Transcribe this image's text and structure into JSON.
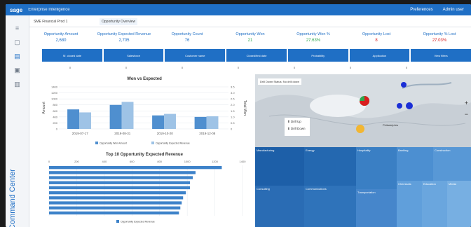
{
  "topbar": {
    "logo": "sage",
    "title": "Enterprise Intelligence",
    "right": [
      "Preferences",
      "Admin user"
    ]
  },
  "sidebar": {
    "command_center": "Command Center",
    "icons": [
      "list-icon",
      "panel-icon",
      "chart-icon",
      "folder-icon",
      "files-icon"
    ]
  },
  "tabs": [
    {
      "label": "SME Financial Prod 1"
    },
    {
      "label": "Opportunity Overview"
    }
  ],
  "kpis": [
    {
      "label": "Opportunity Amount",
      "value": "2,680"
    },
    {
      "label": "Opportunity Expected Revenue",
      "value": "2,705"
    },
    {
      "label": "Opportunity Count",
      "value": "76"
    },
    {
      "label": "Opportunity Won",
      "value": "21"
    },
    {
      "label": "Opportunity Won %",
      "value": "27.63%"
    },
    {
      "label": "Opportunity Lost",
      "value": "8"
    },
    {
      "label": "Opportunity % Lost",
      "value": "27.03%"
    }
  ],
  "filters": [
    "Sf. closed date",
    "Salesforce",
    "Customer name",
    "Closed/first date",
    "Probability",
    "Application",
    "View filters"
  ],
  "filter_values": [
    "0",
    "0",
    "0",
    "0",
    "0",
    "0",
    "0"
  ],
  "win_chart": {
    "title": "Won vs Expected",
    "ylabel": "Amount",
    "y2label": "Total Won",
    "xticks": [
      "2019-07-17",
      "2019-08-31",
      "2019-10-20",
      "2019-12-08"
    ],
    "yticks": [
      "1400",
      "1200",
      "1000",
      "800",
      "600",
      "400",
      "200",
      "0"
    ],
    "y2ticks": [
      "3.5",
      "3.0",
      "2.5",
      "2.0",
      "1.5",
      "1.0",
      "0.5",
      "0"
    ],
    "legend": [
      "Opportunity Won Amount",
      "Opportunity Expected Revenue"
    ]
  },
  "top10": {
    "title": "Top 10 Opportunity Expected Revenue",
    "xticks": [
      "0",
      "200",
      "400",
      "600",
      "800",
      "1000",
      "1200",
      "1400"
    ],
    "legend": "Opportunity Expected Revenue"
  },
  "map": {
    "zoom_label": "Drill Down Status: No drill down",
    "menu": [
      "Drill Up",
      "Drill Down"
    ],
    "city": "Philadelphia"
  },
  "treemap": {
    "labels": [
      "Manufacturing",
      "Energy",
      "Hospitality",
      "Banking",
      "Construction",
      "Consulting",
      "Communications",
      "Transportation",
      "Chemicals",
      "Education",
      "Media"
    ]
  },
  "colors": {
    "accent": "#1f6fc5",
    "green": "#2fa84f",
    "red": "#d91e1e"
  },
  "chart_data": [
    {
      "type": "bar",
      "title": "Won vs Expected",
      "xlabel": "",
      "ylabel": "Amount",
      "ylim": [
        0,
        1400
      ],
      "categories": [
        "2019-07-17",
        "2019-08-31",
        "2019-10-20",
        "2019-12-08"
      ],
      "series": [
        {
          "name": "Opportunity Won Amount",
          "values": [
            650,
            800,
            450,
            400
          ]
        },
        {
          "name": "Opportunity Expected Revenue",
          "values": [
            550,
            900,
            500,
            420
          ]
        }
      ]
    },
    {
      "type": "bar",
      "title": "Top 10 Opportunity Expected Revenue",
      "ylim": [
        0,
        1400
      ],
      "categories": [
        "1",
        "2",
        "3",
        "4",
        "5",
        "6",
        "7",
        "8",
        "9",
        "10"
      ],
      "values": [
        1250,
        1060,
        1040,
        1020,
        1020,
        990,
        970,
        960,
        950,
        940
      ]
    }
  ]
}
